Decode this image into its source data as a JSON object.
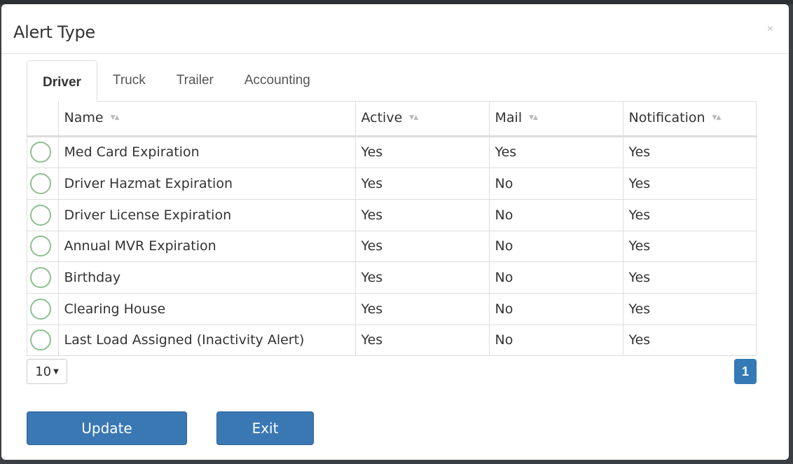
{
  "background": {
    "text": "..."
  },
  "modal": {
    "title": "Alert Type",
    "close_label": "×"
  },
  "tabs": [
    {
      "label": "Driver",
      "active": true
    },
    {
      "label": "Truck",
      "active": false
    },
    {
      "label": "Trailer",
      "active": false
    },
    {
      "label": "Accounting",
      "active": false
    }
  ],
  "table": {
    "columns": [
      "Name",
      "Active",
      "Mail",
      "Notification"
    ],
    "rows": [
      {
        "name": "Med Card Expiration",
        "active": "Yes",
        "mail": "Yes",
        "notification": "Yes"
      },
      {
        "name": "Driver Hazmat Expiration",
        "active": "Yes",
        "mail": "No",
        "notification": "Yes"
      },
      {
        "name": "Driver License Expiration",
        "active": "Yes",
        "mail": "No",
        "notification": "Yes"
      },
      {
        "name": "Annual MVR Expiration",
        "active": "Yes",
        "mail": "No",
        "notification": "Yes"
      },
      {
        "name": "Birthday",
        "active": "Yes",
        "mail": "No",
        "notification": "Yes"
      },
      {
        "name": "Clearing House",
        "active": "Yes",
        "mail": "No",
        "notification": "Yes"
      },
      {
        "name": "Last Load Assigned (Inactivity Alert)",
        "active": "Yes",
        "mail": "No",
        "notification": "Yes"
      }
    ]
  },
  "pager": {
    "page_size": "10",
    "current_page": "1"
  },
  "buttons": {
    "update": "Update",
    "exit": "Exit"
  },
  "colors": {
    "primary": "#3a78b4",
    "radio_border": "#8fbf8f"
  },
  "icons": {
    "sort": "sort-icon",
    "caret": "caret-down-icon",
    "radio": "radio-circle-icon"
  }
}
